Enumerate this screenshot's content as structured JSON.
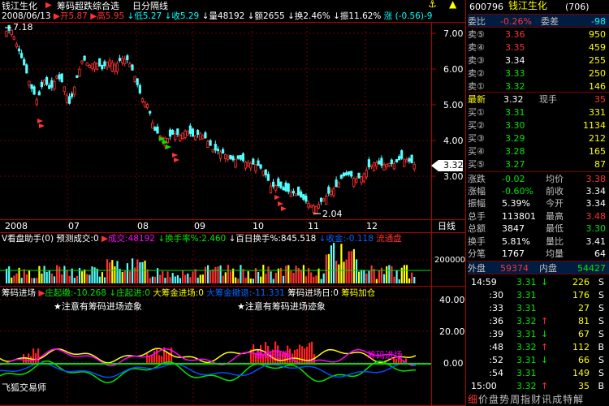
{
  "header": {
    "stock_name": "钱江生化",
    "strategy": "筹码超跌综合选",
    "period": "日分隔线",
    "date": "2008/06/13",
    "open": "开5.87",
    "high": "高5.95",
    "low": "低5.27",
    "close": "收5.29",
    "volume": "量48192",
    "amount": "额2655",
    "turnover": "换2.46%",
    "amplitude": "振11.62%",
    "change": "涨 (-0.56)-9"
  },
  "main_chart": {
    "y_ticks": [
      "7.00",
      "6.00",
      "5.00",
      "4.00",
      "3.00"
    ],
    "high_marker": "7.18",
    "low_marker": "2.04",
    "current_price": "3.32",
    "x_ticks": [
      "2008",
      "07",
      "08",
      "09",
      "10",
      "11",
      "12"
    ],
    "day_label": "日线"
  },
  "volume_panel": {
    "title": "V看盘助手(0)",
    "pred": "预测成交:0",
    "cj": "成交:48192",
    "hsl": "换手率%:2.460",
    "bhs": "百日换手%:845.518",
    "sj": "收金:-0.118",
    "lt": "流通盘",
    "y_tick": "200000"
  },
  "chip_panel": {
    "title": "筹码进场",
    "zz": "庄起缴:-10.268",
    "zq": "庄起进:0",
    "dc": "大筹金进场:0",
    "dt": "大筹金撤退:-11.331",
    "cjr": "筹码进场日:0",
    "jc": "筹码加仓",
    "note1": "★注意有筹码进场迹象",
    "note2": "★注意有筹码进场迹象",
    "label_a": "筹码进场",
    "label_b": "筹码进场",
    "y_ticks": [
      "40.00",
      "20.00",
      "0.00"
    ],
    "footer": "飞狐交易师"
  },
  "quote": {
    "code": "600796",
    "name": "钱江生化",
    "suffix": "(706)",
    "weibi_label": "委比",
    "weibi": "-0.26%",
    "weicha_label": "委差",
    "weicha": "-98",
    "asks": [
      {
        "label": "卖⑤",
        "price": "3.36",
        "vol": "950"
      },
      {
        "label": "卖④",
        "price": "3.35",
        "vol": "459"
      },
      {
        "label": "卖③",
        "price": "3.34",
        "vol": "255"
      },
      {
        "label": "卖②",
        "price": "3.33",
        "vol": "250"
      },
      {
        "label": "卖①",
        "price": "3.32",
        "vol": "146"
      }
    ],
    "last_label": "最新",
    "last": "3.32",
    "xs_label": "现手",
    "xs": "35",
    "bids": [
      {
        "label": "买①",
        "price": "3.31",
        "vol": "331"
      },
      {
        "label": "买②",
        "price": "3.30",
        "vol": "1134"
      },
      {
        "label": "买③",
        "price": "3.29",
        "vol": "212"
      },
      {
        "label": "买④",
        "price": "3.28",
        "vol": "165"
      },
      {
        "label": "买⑤",
        "price": "3.27",
        "vol": "87"
      }
    ],
    "stats": [
      {
        "l1": "涨跌",
        "v1": "-0.02",
        "l2": "均价",
        "v2": "3.38"
      },
      {
        "l1": "涨幅",
        "v1": "-0.60%",
        "l2": "前收",
        "v2": "3.34"
      },
      {
        "l1": "振幅",
        "v1": "5.39%",
        "l2": "今开",
        "v2": "3.34"
      },
      {
        "l1": "总手",
        "v1": "113801",
        "l2": "最高",
        "v2": "3.48"
      },
      {
        "l1": "总额",
        "v1": "3847",
        "l2": "最低",
        "v2": "3.30"
      },
      {
        "l1": "换手",
        "v1": "5.81%",
        "l2": "量比",
        "v2": "3.41"
      },
      {
        "l1": "分笔",
        "v1": "1767",
        "l2": "均量",
        "v2": "64"
      }
    ],
    "wp_label": "外盘",
    "wp": "59374",
    "np_label": "内盘",
    "np": "54427"
  },
  "ticks": [
    {
      "t": "14:59",
      "p": "3.31",
      "d": "↓",
      "v": "226",
      "s": "S"
    },
    {
      "t": ":30",
      "p": "3.31",
      "d": "",
      "v": "176",
      "s": "S"
    },
    {
      "t": ":33",
      "p": "3.31",
      "d": "",
      "v": "27",
      "s": "S"
    },
    {
      "t": ":36",
      "p": "3.32",
      "d": "↑",
      "v": "81",
      "s": "S"
    },
    {
      "t": ":39",
      "p": "3.31",
      "d": "↓",
      "v": "67",
      "s": "S"
    },
    {
      "t": ":48",
      "p": "3.32",
      "d": "↑",
      "v": "112",
      "s": "B"
    },
    {
      "t": ":52",
      "p": "3.31",
      "d": "↓",
      "v": "66",
      "s": "S"
    },
    {
      "t": ":54",
      "p": "3.31",
      "d": "",
      "v": "149",
      "s": "S"
    },
    {
      "t": "15:00",
      "p": "3.32",
      "d": "↑",
      "v": "35",
      "s": "B"
    }
  ],
  "bottom_tabs": [
    "细",
    "价",
    "盘",
    "势",
    "周",
    "指",
    "财",
    "讯",
    "成",
    "特",
    "解"
  ]
}
